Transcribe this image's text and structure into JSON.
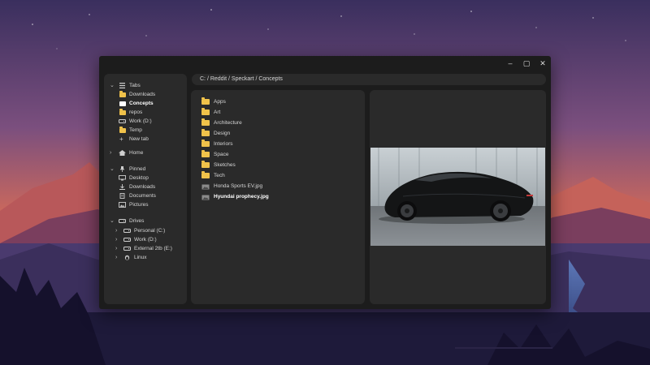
{
  "window": {
    "controls": {
      "minimize": "–",
      "maximize": "▢",
      "close": "✕"
    }
  },
  "sidebar": {
    "tabs_header": "Tabs",
    "tabs": [
      "Downloads",
      "Concepts",
      "repos",
      "Work (D:)",
      "Temp",
      "New tab"
    ],
    "home": "Home",
    "pinned_header": "Pinned",
    "pinned": [
      "Desktop",
      "Downloads",
      "Documents",
      "Pictures"
    ],
    "drives_header": "Drives",
    "drives": [
      "Personal (C:)",
      "Work (D:)",
      "External 2tb (E:)",
      "Linux"
    ]
  },
  "breadcrumb": {
    "path": "C: / Reddit / Speckart / Concepts"
  },
  "files": {
    "items": [
      {
        "name": "Apps",
        "type": "folder"
      },
      {
        "name": "Art",
        "type": "folder"
      },
      {
        "name": "Architecture",
        "type": "folder"
      },
      {
        "name": "Design",
        "type": "folder"
      },
      {
        "name": "Interiors",
        "type": "folder"
      },
      {
        "name": "Space",
        "type": "folder"
      },
      {
        "name": "Sketches",
        "type": "folder"
      },
      {
        "name": "Tech",
        "type": "folder"
      },
      {
        "name": "Honda Sports EV.jpg",
        "type": "image"
      },
      {
        "name": "Hyundai prophecy.jpg",
        "type": "image",
        "selected": true
      }
    ]
  },
  "colors": {
    "window_bg": "#1c1c1c",
    "panel_bg": "#2a2a2a",
    "folder": "#f0c24a",
    "text": "#d6d6d6"
  },
  "icons": {
    "tabs": "tabs-icon",
    "folder": "folder-icon",
    "new_tab": "plus-icon",
    "home": "home-icon",
    "pinned": "pin-icon",
    "desktop": "desktop-icon",
    "downloads": "download-icon",
    "documents": "document-icon",
    "pictures": "image-icon",
    "drive": "drive-icon",
    "linux": "linux-icon",
    "image_file": "image-file-icon"
  }
}
